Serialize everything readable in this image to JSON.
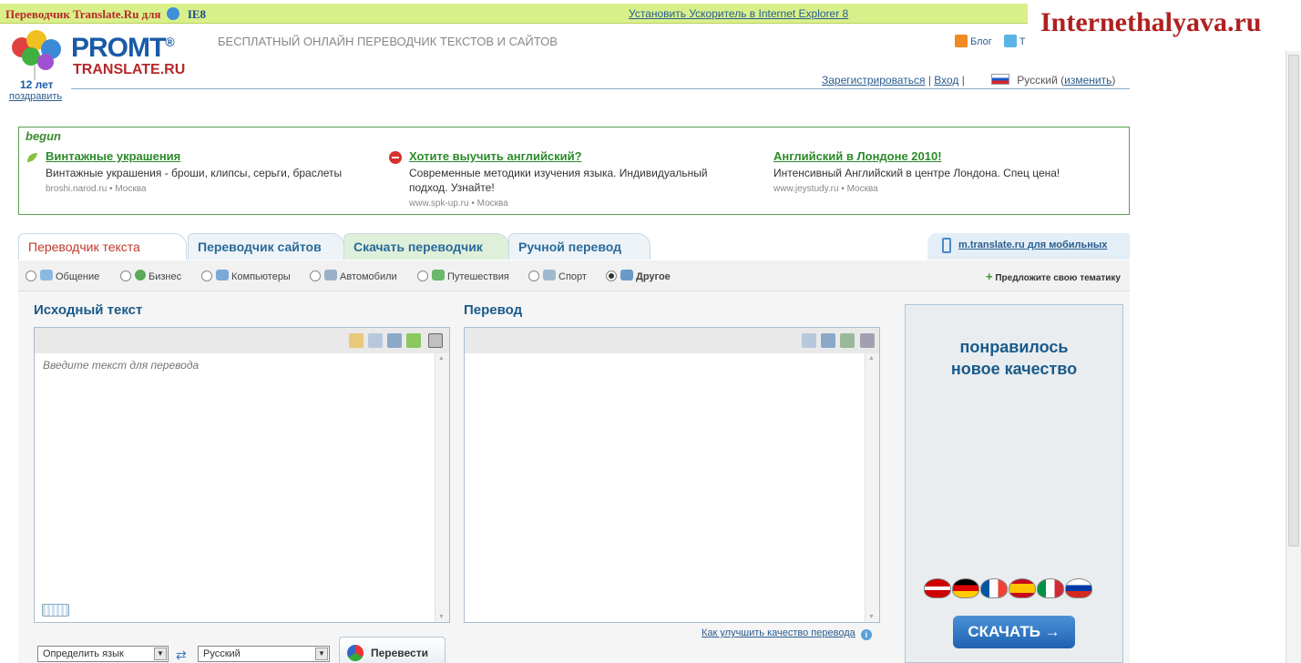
{
  "topbar": {
    "title": "Переводчик Translate.Ru для",
    "ie_label": "IE8",
    "install_link": "Установить Ускоритель в Internet Explorer 8"
  },
  "watermark": "Internethalyava.ru",
  "logo": {
    "brand": "PROMT",
    "reg": "®",
    "sub": "TRANSLATE.RU",
    "years": "12 лет",
    "congrat": "поздравить"
  },
  "tagline": "БЕСПЛАТНЫЙ ОНЛАЙН ПЕРЕВОДЧИК ТЕКСТОВ И САЙТОВ",
  "header_links": {
    "blog": "Блог",
    "twitter": "T",
    "register": "Зарегистрироваться",
    "login": "Вход",
    "sep": "|",
    "lang": "Русский",
    "change": "изменить"
  },
  "ads": {
    "brand": "begun",
    "items": [
      {
        "title": "Винтажные украшения",
        "desc": "Винтажные украшения - броши, клипсы, серьги, браслеты",
        "url": "broshi.narod.ru",
        "city": "Москва"
      },
      {
        "title": "Хотите выучить английский?",
        "desc": "Современные методики изучения языка. Индивидуальный подход. Узнайте!",
        "url": "www.spk-up.ru",
        "city": "Москва"
      },
      {
        "title": "Английский в Лондоне 2010!",
        "desc": "Интенсивный Английский в центре Лондона. Спец цена!",
        "url": "www.jeystudy.ru",
        "city": "Москва"
      }
    ]
  },
  "tabs": [
    {
      "label": "Переводчик текста"
    },
    {
      "label": "Переводчик сайтов"
    },
    {
      "label": "Скачать переводчик"
    },
    {
      "label": "Ручной перевод"
    }
  ],
  "mobile_link": "m.translate.ru для мобильных",
  "topics": [
    {
      "label": "Общение",
      "selected": false
    },
    {
      "label": "Бизнес",
      "selected": false
    },
    {
      "label": "Компьютеры",
      "selected": false
    },
    {
      "label": "Автомобили",
      "selected": false
    },
    {
      "label": "Путешествия",
      "selected": false
    },
    {
      "label": "Спорт",
      "selected": false
    },
    {
      "label": "Другое",
      "selected": true
    }
  ],
  "suggest_topic": "Предложите свою тематику",
  "source": {
    "title": "Исходный текст",
    "placeholder": "Введите текст для перевода"
  },
  "target": {
    "title": "Перевод"
  },
  "improve_link": "Как улучшить качество перевода",
  "controls": {
    "from_lang": "Определить язык",
    "to_lang": "Русский",
    "translate_button": "Перевести"
  },
  "banner": {
    "line1": "понравилось",
    "line2": "новое качество",
    "download": "СКАЧАТЬ →"
  },
  "colors": {
    "topbar_bg": "#d9f08a",
    "brand_blue": "#1a5aa8",
    "brand_red": "#b5292a",
    "ad_green": "#2c8a2a"
  }
}
